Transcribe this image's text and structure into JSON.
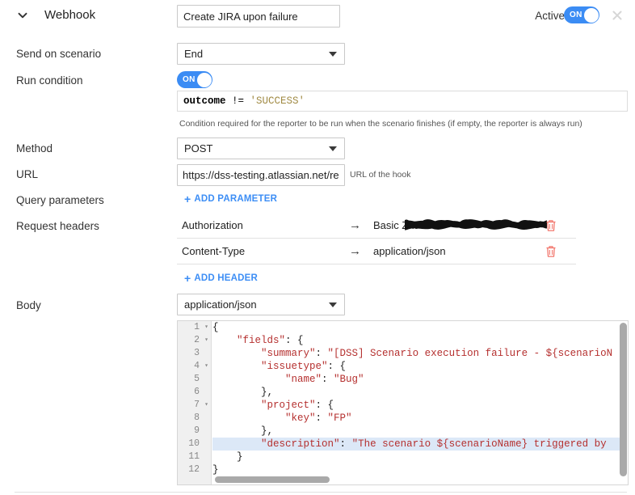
{
  "header": {
    "chevron_icon": "chevron-down-icon",
    "title": "Webhook",
    "name_value": "Create JIRA upon failure",
    "name_placeholder": "Name",
    "active_label": "Active",
    "active_toggle": "ON",
    "close_icon": "close-icon"
  },
  "fields": {
    "send_on_scenario": {
      "label": "Send on scenario",
      "value": "End"
    },
    "run_condition": {
      "label": "Run condition",
      "toggle": "ON",
      "expression": {
        "variable": "outcome",
        "operator": " != ",
        "string": "'SUCCESS'"
      },
      "help": "Condition required for the reporter to be run when the scenario finishes (if empty, the reporter is always run)"
    },
    "method": {
      "label": "Method",
      "value": "POST"
    },
    "url": {
      "label": "URL",
      "value": "https://dss-testing.atlassian.net/rest",
      "placeholder": "URL",
      "help": "URL of the hook"
    },
    "query_parameters": {
      "label": "Query parameters",
      "add_label": "ADD PARAMETER",
      "plus": "+"
    },
    "request_headers": {
      "label": "Request headers",
      "add_label": "ADD HEADER",
      "plus": "+",
      "arrow": "→",
      "rows": [
        {
          "key": "Authorization",
          "value": "Basic ZnJ",
          "redacted": true,
          "delete_icon": "trash-icon"
        },
        {
          "key": "Content-Type",
          "value": "application/json",
          "redacted": false,
          "delete_icon": "trash-icon"
        }
      ]
    },
    "body": {
      "label": "Body",
      "content_type": "application/json"
    }
  },
  "editor": {
    "active_line": 10,
    "lines": [
      {
        "n": "1",
        "fold": "▾",
        "text": "{"
      },
      {
        "n": "2",
        "fold": "▾",
        "text": "    \"fields\": {"
      },
      {
        "n": "3",
        "fold": "",
        "text": "        \"summary\": \"[DSS] Scenario execution failure - ${scenarioN"
      },
      {
        "n": "4",
        "fold": "▾",
        "text": "        \"issuetype\": {"
      },
      {
        "n": "5",
        "fold": "",
        "text": "            \"name\": \"Bug\""
      },
      {
        "n": "6",
        "fold": "",
        "text": "        },"
      },
      {
        "n": "7",
        "fold": "▾",
        "text": "        \"project\": {"
      },
      {
        "n": "8",
        "fold": "",
        "text": "            \"key\": \"FP\""
      },
      {
        "n": "9",
        "fold": "",
        "text": "        },"
      },
      {
        "n": "10",
        "fold": "",
        "text": "        \"description\": \"The scenario ${scenarioName} triggered by"
      },
      {
        "n": "11",
        "fold": "",
        "text": "    }"
      },
      {
        "n": "12",
        "fold": "",
        "text": "}"
      }
    ]
  },
  "colors": {
    "accent_blue": "#3b8cf4",
    "link_blue": "#3d8ef5",
    "delete_red": "#f2776d",
    "code_string_red": "#b5302f",
    "condition_string": "#a08a43",
    "active_line_bg": "#dce8f7"
  }
}
